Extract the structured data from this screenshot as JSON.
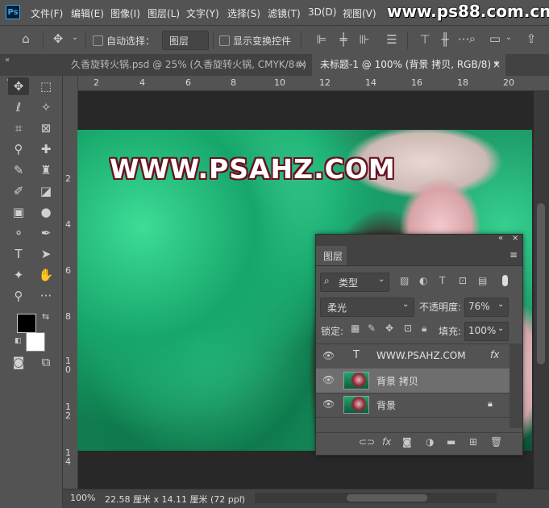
{
  "app": {
    "logo": "Ps",
    "watermark": "www.ps88.com.cn"
  },
  "menu": [
    "文件(F)",
    "编辑(E)",
    "图像(I)",
    "图层(L)",
    "文字(Y)",
    "选择(S)",
    "滤镜(T)",
    "3D(D)",
    "视图(V)"
  ],
  "options": {
    "auto_select_label": "自动选择：",
    "auto_select_target": "图层",
    "show_transform_label": "显示变换控件"
  },
  "tabs": [
    {
      "label": "久香旋转火锅.psd @ 25% (久香旋转火锅, CMYK/8#)",
      "close": "×",
      "active": false
    },
    {
      "label": "未标题-1 @ 100% (背景 拷贝, RGB/8) *",
      "close": "×",
      "active": true
    }
  ],
  "rulers": {
    "top": [
      "2",
      "4",
      "6",
      "8",
      "10",
      "12",
      "14",
      "16",
      "18",
      "20"
    ],
    "left": [
      "2",
      "4",
      "6",
      "8",
      "1\n0",
      "1\n2",
      "1\n4"
    ]
  },
  "canvas": {
    "overlay_text": "WWW.PSAHZ.COM"
  },
  "status": {
    "zoom": "100%",
    "doc_size": "22.58 厘米 x 14.11 厘米 (72 ppi)"
  },
  "layers_panel": {
    "title": "图层",
    "filter_label": "类型",
    "blend_mode": "柔光",
    "opacity_label": "不透明度:",
    "opacity_value": "76%",
    "lock_label": "锁定:",
    "fill_label": "填充:",
    "fill_value": "100%",
    "layers": [
      {
        "name": "WWW.PSAHZ.COM",
        "type": "text",
        "fx": "fx",
        "selected": false
      },
      {
        "name": "背景 拷贝",
        "type": "image",
        "selected": true
      },
      {
        "name": "背景",
        "type": "image",
        "locked": true,
        "selected": false
      }
    ]
  },
  "colors": {
    "ui_bg": "#535353",
    "canvas_bg": "#282828",
    "selected_layer": "#6e6e6e",
    "foreground": "#000000",
    "background": "#ffffff"
  }
}
